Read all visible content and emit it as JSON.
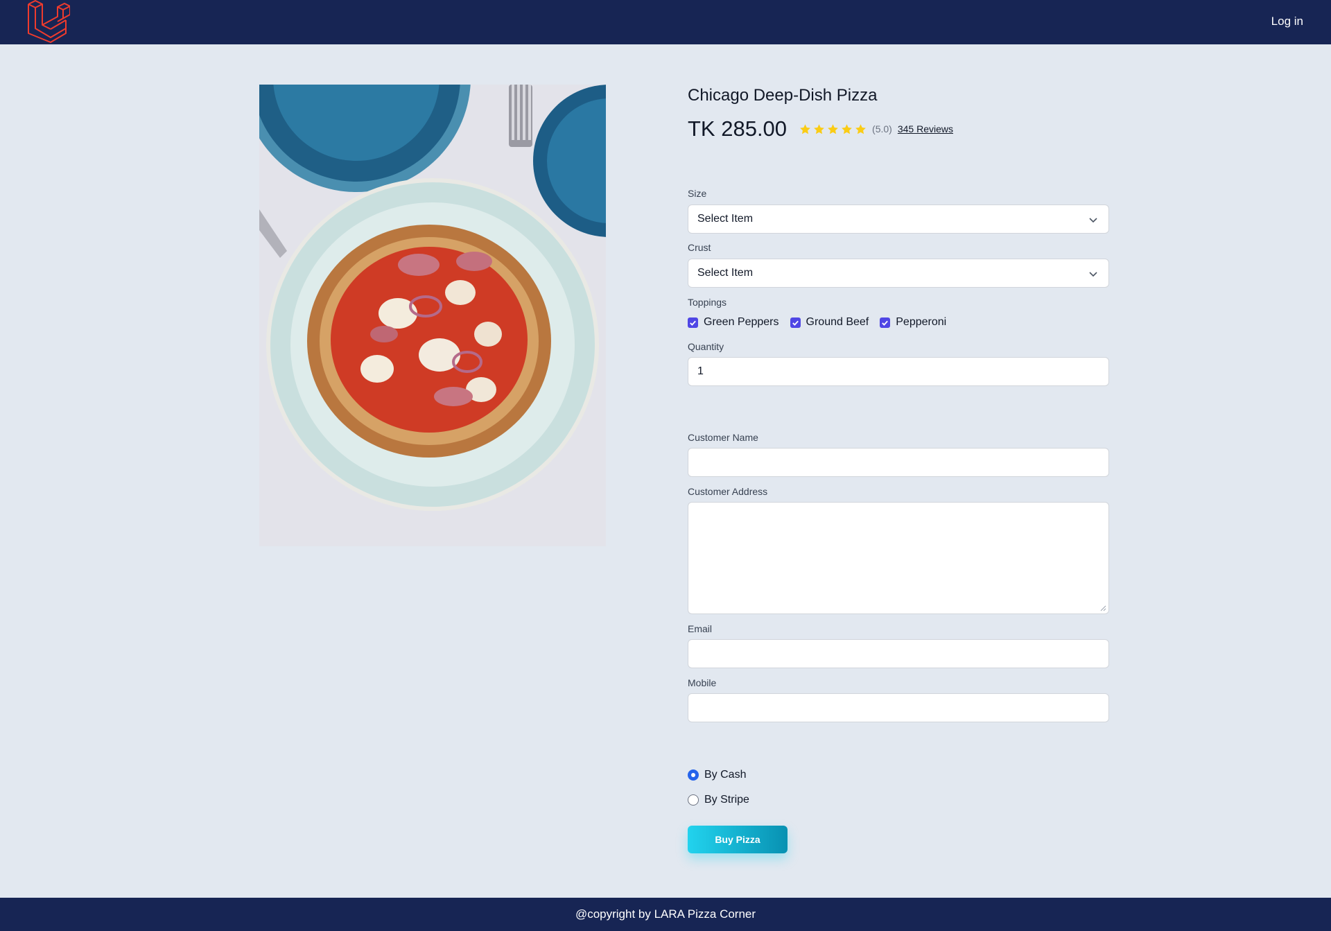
{
  "nav": {
    "login_label": "Log in"
  },
  "product": {
    "title": "Chicago Deep-Dish Pizza",
    "price": "TK 285.00",
    "rating_value": 5,
    "rating_text": "(5.0)",
    "reviews_link": "345 Reviews"
  },
  "form": {
    "size": {
      "label": "Size",
      "selected": "Select Item"
    },
    "crust": {
      "label": "Crust",
      "selected": "Select Item"
    },
    "toppings": {
      "label": "Toppings",
      "items": [
        {
          "label": "Green Peppers",
          "checked": true
        },
        {
          "label": "Ground Beef",
          "checked": true
        },
        {
          "label": "Pepperoni",
          "checked": true
        }
      ]
    },
    "quantity": {
      "label": "Quantity",
      "value": "1"
    },
    "customer_name": {
      "label": "Customer Name",
      "value": ""
    },
    "customer_address": {
      "label": "Customer Address",
      "value": ""
    },
    "email": {
      "label": "Email",
      "value": ""
    },
    "mobile": {
      "label": "Mobile",
      "value": ""
    },
    "payment": {
      "options": [
        {
          "label": "By Cash",
          "checked": true
        },
        {
          "label": "By Stripe",
          "checked": false
        }
      ]
    },
    "submit_label": "Buy Pizza"
  },
  "footer": {
    "text": "@copyright by LARA Pizza Corner"
  },
  "colors": {
    "navbar": "#172554",
    "page_background": "#e2e8f0",
    "checkbox": "#4f46e5",
    "star": "#facc15",
    "button_start": "#22d3ee",
    "button_end": "#0891b2",
    "logo": "#ef3b2d"
  },
  "icons": [
    "laravel-logo",
    "star-icon",
    "chevron-down-icon",
    "check-icon"
  ]
}
